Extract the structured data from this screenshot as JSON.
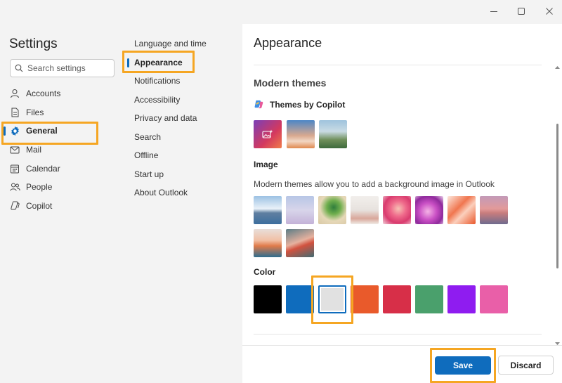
{
  "window": {
    "controls": [
      "minimize",
      "maximize",
      "close"
    ]
  },
  "sidebar": {
    "title": "Settings",
    "search_placeholder": "Search settings",
    "items": [
      {
        "label": "Accounts",
        "icon": "person-icon"
      },
      {
        "label": "Files",
        "icon": "file-icon"
      },
      {
        "label": "General",
        "icon": "gear-icon",
        "active": true
      },
      {
        "label": "Mail",
        "icon": "mail-icon"
      },
      {
        "label": "Calendar",
        "icon": "calendar-icon"
      },
      {
        "label": "People",
        "icon": "people-icon"
      },
      {
        "label": "Copilot",
        "icon": "copilot-icon"
      }
    ]
  },
  "subnav": {
    "items": [
      {
        "label": "Language and time"
      },
      {
        "label": "Appearance",
        "active": true
      },
      {
        "label": "Notifications"
      },
      {
        "label": "Accessibility"
      },
      {
        "label": "Privacy and data"
      },
      {
        "label": "Search"
      },
      {
        "label": "Offline"
      },
      {
        "label": "Start up"
      },
      {
        "label": "About Outlook"
      }
    ]
  },
  "main": {
    "title": "Appearance",
    "modern_themes_heading": "Modern themes",
    "copilot_themes_label": "Themes by Copilot",
    "image_label": "Image",
    "image_description": "Modern themes allow you to add a background image in Outlook",
    "color_label": "Color",
    "colors": [
      "#000000",
      "#0f6cbd",
      "#e1e1e1",
      "#e95a2b",
      "#d72f48",
      "#4aa06c",
      "#8f1cf0",
      "#e95fa8"
    ],
    "selected_color_index": 2
  },
  "footer": {
    "save_label": "Save",
    "discard_label": "Discard"
  },
  "accent": "#0f6cbd",
  "highlight": "#f5a623"
}
